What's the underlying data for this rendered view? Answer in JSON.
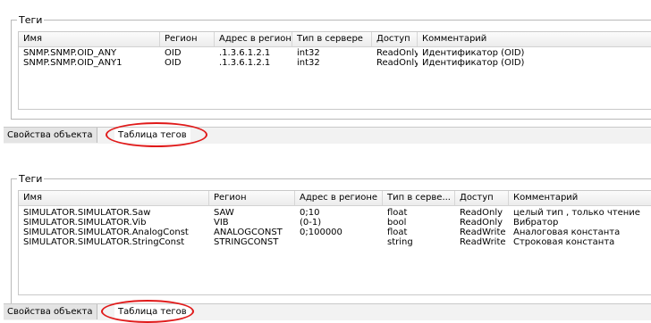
{
  "colors": {
    "highlight": "#e01a1a",
    "grid_border": "#c9c9c9",
    "tab_strip": "#f2f2f2"
  },
  "top": {
    "group_title": "Теги",
    "columns": [
      "Имя",
      "Регион",
      "Адрес в регионе",
      "Тип в сервере",
      "Доступ",
      "Комментарий"
    ],
    "rows": [
      [
        "SNMP.SNMP.OID_ANY",
        "OID",
        ".1.3.6.1.2.1",
        "int32",
        "ReadOnly",
        "Идентификатор (OID)"
      ],
      [
        "SNMP.SNMP.OID_ANY1",
        "OID",
        ".1.3.6.1.2.1",
        "int32",
        "ReadOnly",
        "Идентификатор (OID)"
      ]
    ],
    "tabs": {
      "properties": "Свойства объекта",
      "tag_table": "Таблица тегов"
    }
  },
  "bottom": {
    "group_title": "Теги",
    "columns": [
      "Имя",
      "Регион",
      "Адрес в регионе",
      "Тип в серве...",
      "Доступ",
      "Комментарий"
    ],
    "rows": [
      [
        "SIMULATOR.SIMULATOR.Saw",
        "SAW",
        "0;10",
        "float",
        "ReadOnly",
        "целый тип , только чтение"
      ],
      [
        "SIMULATOR.SIMULATOR.Vib",
        "VIB",
        "(0-1)",
        "bool",
        "ReadOnly",
        "Вибратор"
      ],
      [
        "SIMULATOR.SIMULATOR.AnalogConst",
        "ANALOGCONST",
        "0;100000",
        "float",
        "ReadWrite",
        "Аналоговая константа"
      ],
      [
        "SIMULATOR.SIMULATOR.StringConst",
        "STRINGCONST",
        "",
        "string",
        "ReadWrite",
        "Строковая константа"
      ]
    ],
    "tabs": {
      "properties": "Свойства объекта",
      "tag_table": "Таблица тегов"
    }
  }
}
